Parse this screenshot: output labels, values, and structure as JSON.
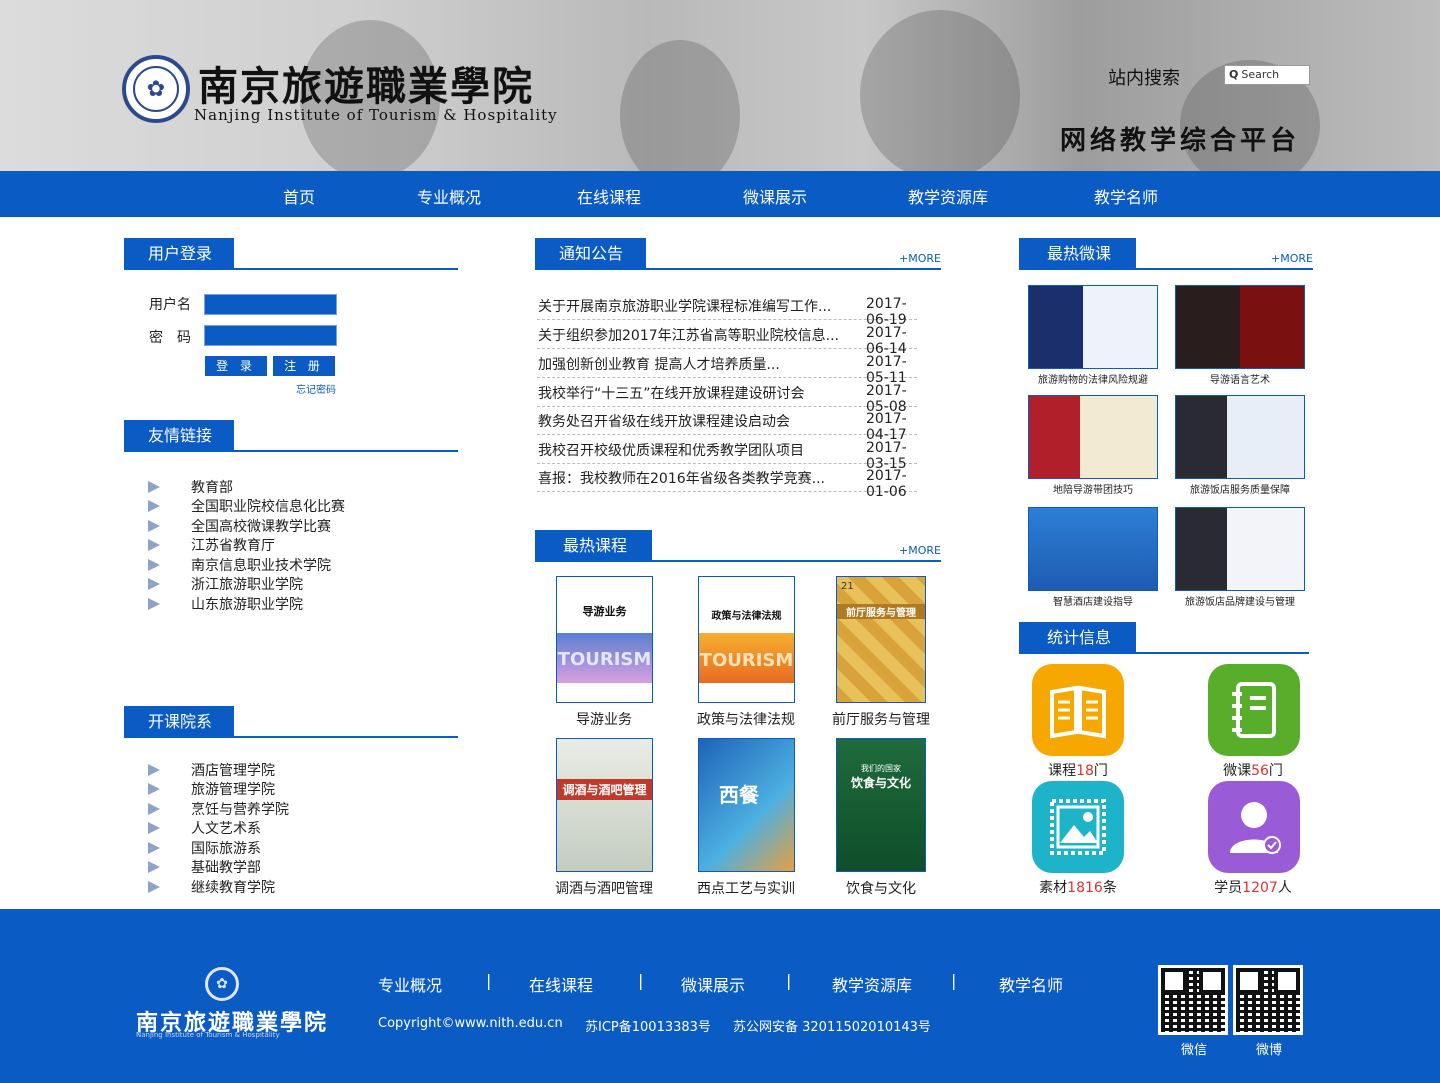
{
  "header": {
    "school_name_cn": "南京旅遊職業學院",
    "school_name_en": "Nanjing Institute of Tourism & Hospitality",
    "site_search_label": "站内搜索",
    "search_placeholder": "Search",
    "platform_title": "网络教学综合平台"
  },
  "nav": [
    "首页",
    "专业概况",
    "在线课程",
    "微课展示",
    "教学资源库",
    "教学名师"
  ],
  "login": {
    "title": "用户登录",
    "username_label": "用户名",
    "password_label": "密　码",
    "login_button": "登 录",
    "register_button": "注 册",
    "forgot_link": "忘记密码"
  },
  "friend_links": {
    "title": "友情链接",
    "items": [
      "教育部",
      "全国职业院校信息化比赛",
      "全国高校微课教学比赛",
      "江苏省教育厅",
      "南京信息职业技术学院",
      "浙江旅游职业学院",
      "山东旅游职业学院"
    ]
  },
  "departments": {
    "title": "开课院系",
    "items": [
      "酒店管理学院",
      "旅游管理学院",
      "烹饪与营养学院",
      "人文艺术系",
      "国际旅游系",
      "基础教学部",
      "继续教育学院"
    ]
  },
  "notices": {
    "title": "通知公告",
    "more": "+MORE",
    "items": [
      {
        "title": "关于开展南京旅游职业学院课程标准编写工作...",
        "date": "2017-06-19"
      },
      {
        "title": "关于组织参加2017年江苏省高等职业院校信息...",
        "date": "2017-06-14"
      },
      {
        "title": "加强创新创业教育 提高人才培养质量...",
        "date": "2017-05-11"
      },
      {
        "title": "我校举行“十三五”在线开放课程建设研讨会",
        "date": "2017-05-08"
      },
      {
        "title": "教务处召开省级在线开放课程建设启动会",
        "date": "2017-04-17"
      },
      {
        "title": "我校召开校级优质课程和优秀教学团队项目",
        "date": "2017-03-15"
      },
      {
        "title": "喜报：我校教师在2016年省级各类教学竞赛...",
        "date": "2017-01-06"
      }
    ]
  },
  "hot_courses": {
    "title": "最热课程",
    "more": "+MORE",
    "items": [
      {
        "name": "导游业务",
        "cover_title": "导游业务",
        "cover_sub": "TOURISM"
      },
      {
        "name": "政策与法律法规",
        "cover_title": "政策与法律法规",
        "cover_sub": "TOURISM"
      },
      {
        "name": "前厅服务与管理",
        "cover_title": "前厅服务与管理",
        "cover_sub": "21"
      },
      {
        "name": "调酒与酒吧管理",
        "cover_title": "调酒与酒吧管理",
        "cover_sub": ""
      },
      {
        "name": "西点工艺与实训",
        "cover_title": "西餐",
        "cover_sub": ""
      },
      {
        "name": "饮食与文化",
        "cover_title": "饮食与文化",
        "cover_sub": "我们的国家"
      }
    ]
  },
  "hot_videos": {
    "title": "最热微课",
    "more": "+MORE",
    "items": [
      "旅游购物的法律风险规避",
      "导游语言艺术",
      "地陪导游带团技巧",
      "旅游饭店服务质量保障",
      "智慧酒店建设指导",
      "旅游饭店品牌建设与管理"
    ]
  },
  "stats": {
    "title": "统计信息",
    "items": [
      {
        "prefix": "课程",
        "count": "18",
        "suffix": "门",
        "icon": "book-icon",
        "color": "#f6a800"
      },
      {
        "prefix": "微课",
        "count": "56",
        "suffix": "门",
        "icon": "notebook-icon",
        "color": "#58ad2a"
      },
      {
        "prefix": "素材",
        "count": "1816",
        "suffix": "条",
        "icon": "image-icon",
        "color": "#1db4c9"
      },
      {
        "prefix": "学员",
        "count": "1207",
        "suffix": "人",
        "icon": "user-icon",
        "color": "#9a5cd6"
      }
    ]
  },
  "footer": {
    "school_name_cn": "南京旅遊職業學院",
    "school_name_en": "Nanjing Institute of Tourism & Hospitality",
    "nav": [
      "专业概况",
      "在线课程",
      "微课展示",
      "教学资源库",
      "教学名师"
    ],
    "separator": "|",
    "copyright": "Copyright©www.nith.edu.cn",
    "icp": "苏ICP备10013383号",
    "police": "苏公网安备 32011502010143号",
    "qr_labels": [
      "微信",
      "微博"
    ]
  }
}
